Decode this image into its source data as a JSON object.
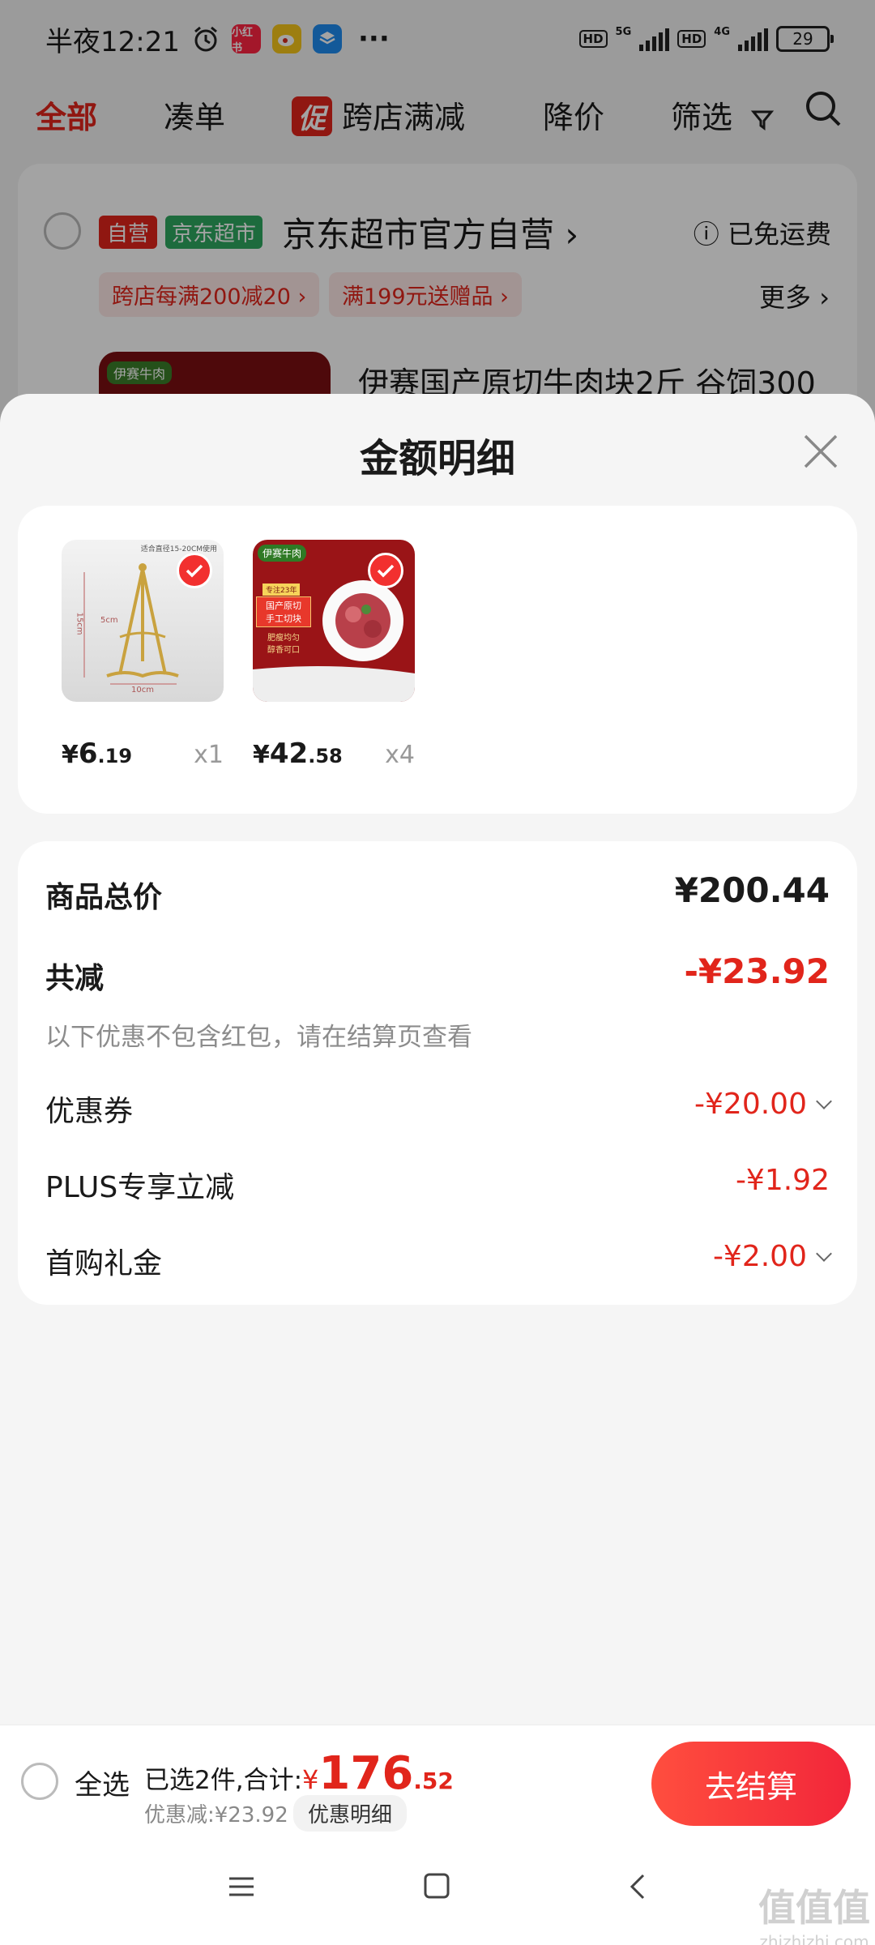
{
  "status_bar": {
    "time": "半夜12:21",
    "apps": [
      "小红书",
      "微博",
      "应用"
    ],
    "more": "···",
    "net1": "5G",
    "net2": "4G",
    "hd": "HD",
    "battery": "29"
  },
  "tabs": [
    {
      "label": "全部",
      "active": true
    },
    {
      "label": "凑单"
    },
    {
      "label": "跨店满减",
      "tag": "促"
    },
    {
      "label": "降价"
    },
    {
      "label": "筛选"
    }
  ],
  "store_card": {
    "tag_self": "自营",
    "tag_super": "京东超市",
    "shop_name": "京东超市官方自营",
    "shipping": "已免运费",
    "chips": [
      "跨店每满200减20",
      "满199元送赠品"
    ],
    "more": "更多",
    "product_title": "伊赛国产原切牛肉块2斤 谷饲300",
    "thumb_brand": "伊赛牛肉"
  },
  "sheet": {
    "title": "金额明细",
    "products": [
      {
        "price_int": "6",
        "price_dec": ".19",
        "qty": "x1",
        "img_text_top": "适合直径15-20CM使用",
        "img_dim_h": "15cm",
        "img_dim_w": "10cm",
        "img_dim_side": "5cm"
      },
      {
        "price_int": "42",
        "price_dec": ".58",
        "qty": "x4",
        "brand": "伊赛牛肉",
        "ribbon": "专注23年",
        "label1": "国产原切",
        "label2": "手工切块",
        "label3": "肥瘦均匀",
        "label4": "醇香可口"
      }
    ],
    "summary": {
      "total_label": "商品总价",
      "total_value": "¥200.44",
      "reduce_label": "共减",
      "reduce_value": "-¥23.92",
      "note": "以下优惠不包含红包，请在结算页查看",
      "lines": [
        {
          "label": "优惠券",
          "value": "-¥20.00",
          "expandable": true
        },
        {
          "label": "PLUS专享立减",
          "value": "-¥1.92",
          "expandable": false
        },
        {
          "label": "首购礼金",
          "value": "-¥2.00",
          "expandable": true
        }
      ]
    }
  },
  "bottom_bar": {
    "select_all": "全选",
    "count_text": "已选2件,合计:",
    "currency": "¥",
    "total_int": "176",
    "total_dec": ".52",
    "discount_text": "优惠减:¥23.92",
    "detail_button": "优惠明细",
    "checkout": "去结算"
  },
  "watermark": {
    "text": "值值值",
    "sub": "zhizhizhi.com"
  },
  "colors": {
    "accent": "#e1251b",
    "green": "#2ea860"
  }
}
